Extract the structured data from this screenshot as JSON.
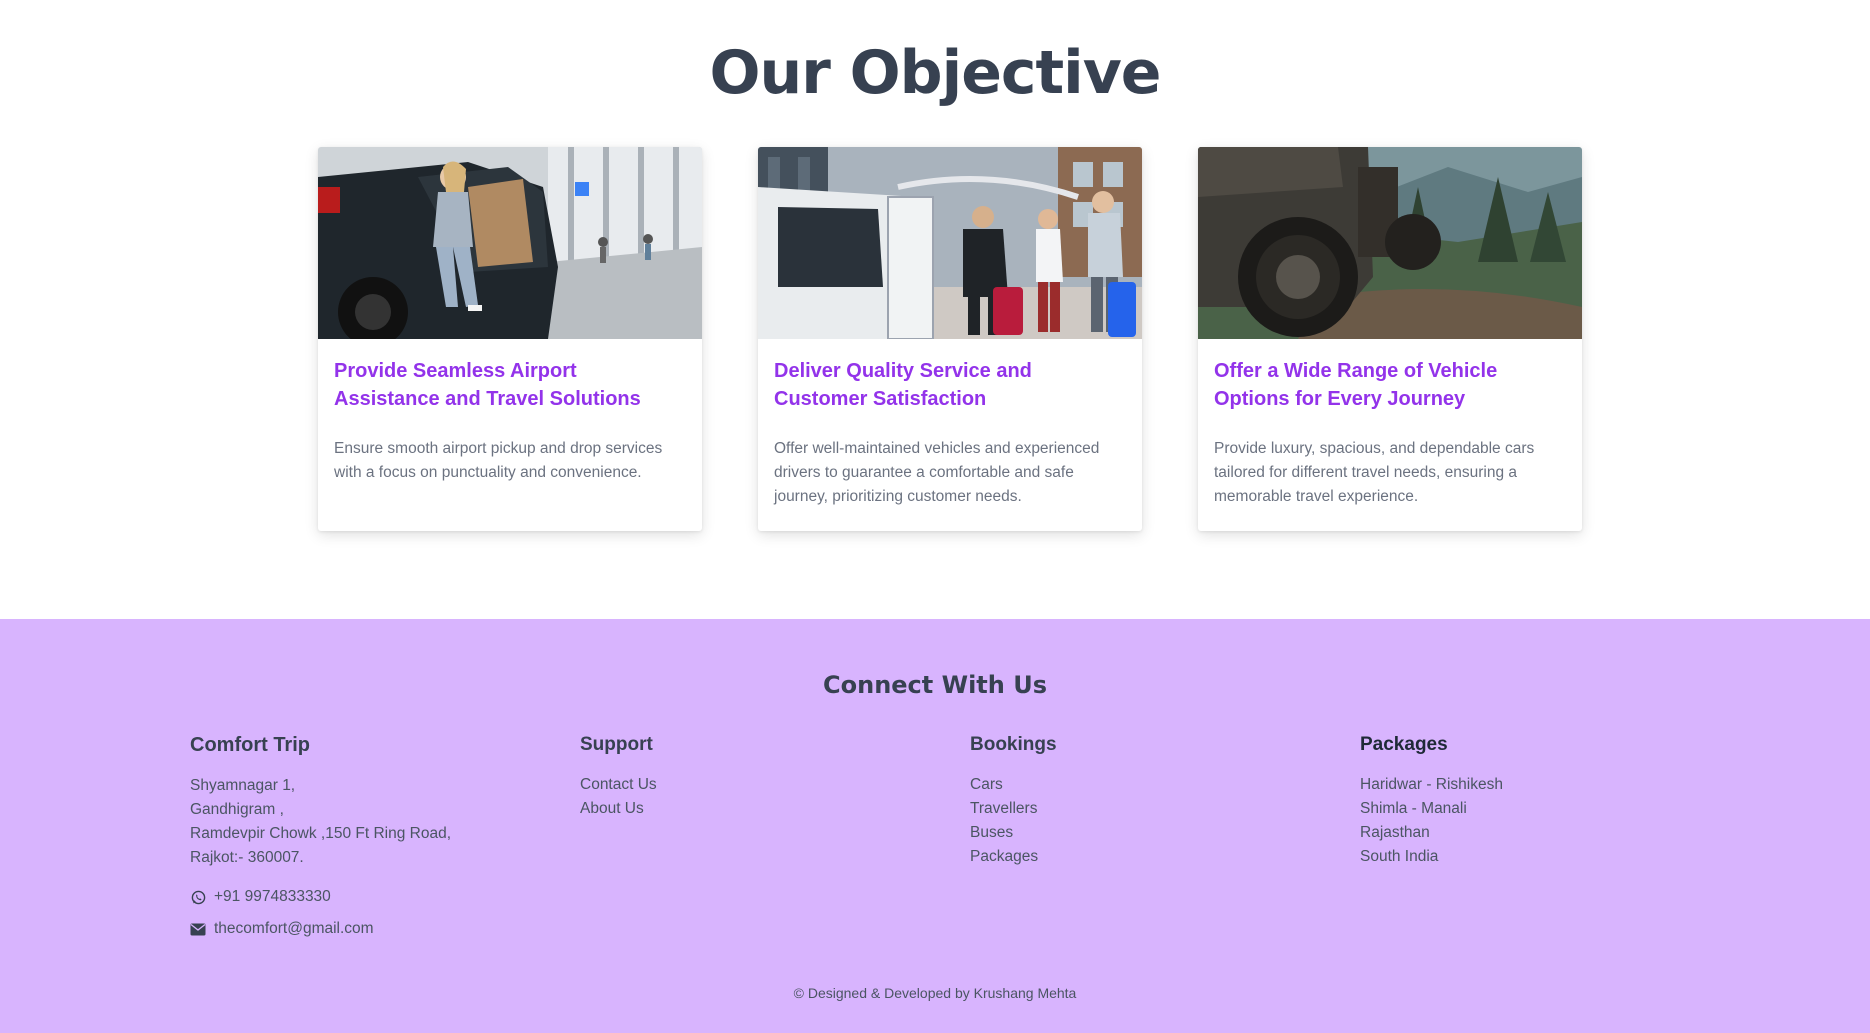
{
  "objective": {
    "title": "Our Objective",
    "cards": [
      {
        "title": "Provide Seamless Airport Assistance and Travel Solutions",
        "description": "Ensure smooth airport pickup and drop services with a focus on punctuality and convenience."
      },
      {
        "title": "Deliver Quality Service and Customer Satisfaction",
        "description": "Offer well-maintained vehicles and experienced drivers to guarantee a comfortable and safe journey, prioritizing customer needs."
      },
      {
        "title": "Offer a Wide Range of Vehicle Options for Every Journey",
        "description": "Provide luxury, spacious, and dependable cars tailored for different travel needs, ensuring a memorable travel experience."
      }
    ]
  },
  "footer": {
    "heading": "Connect With Us",
    "company": {
      "name": "Comfort Trip",
      "address": [
        "Shyamnagar 1,",
        "Gandhigram ,",
        "Ramdevpir Chowk ,150 Ft Ring Road,",
        "Rajkot:- 360007."
      ],
      "phone": "+91 9974833330",
      "email": "thecomfort@gmail.com"
    },
    "support": {
      "title": "Support",
      "links": [
        "Contact Us",
        "About Us"
      ]
    },
    "bookings": {
      "title": "Bookings",
      "links": [
        "Cars",
        "Travellers",
        "Buses",
        "Packages"
      ]
    },
    "packages": {
      "title": "Packages",
      "links": [
        "Haridwar - Rishikesh",
        "Shimla - Manali",
        "Rajasthan",
        "South India"
      ]
    },
    "copyright": "© Designed & Developed by Krushang Mehta",
    "colors": {
      "background": "#d8b4fe",
      "accent": "#9333ea"
    }
  },
  "icons": {
    "phone": "whatsapp-icon",
    "email": "envelope-icon"
  }
}
